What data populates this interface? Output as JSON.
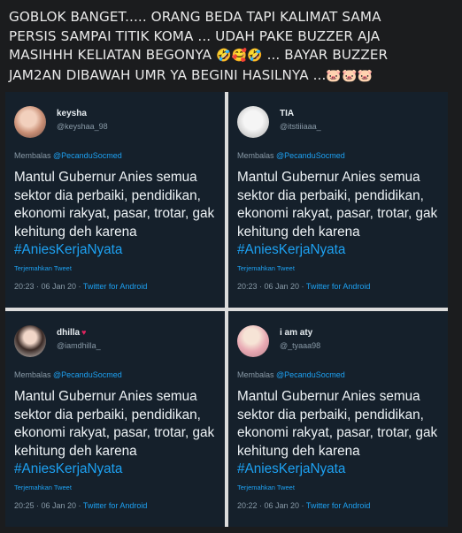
{
  "caption": {
    "line1": "GOBLOK BANGET..... ORANG BEDA TAPI KALIMAT SAMA",
    "line2": "PERSIS SAMPAI TITIK KOMA ... UDAH PAKE BUZZER AJA",
    "line3_text": "MASIHHH KELIATAN BEGONYA",
    "line3_emojis": "🤣🥰🤣",
    "line3_tail": "... BAYAR BUZZER",
    "line4_text": "JAM2AN DIBAWAH UMR YA BEGINI HASILNYA ...",
    "line4_emojis": "🐷🐷🐷"
  },
  "tweets": [
    {
      "name": "keysha",
      "handle": "@keyshaa_98",
      "reply_prefix": "Membalas",
      "mention": "@PecanduSocmed",
      "text": "Mantul Gubernur Anies semua sektor dia perbaiki, pendidikan, ekonomi rakyat, pasar, trotar, gak kehitung deh karena",
      "hashtag": "#AniesKerjaNyata",
      "translate": "Terjemahkan Tweet",
      "time": "20:23 · 06 Jan 20 ·",
      "via": "Twitter for Android"
    },
    {
      "name": "TIA",
      "handle": "@itstiiiaaa_",
      "reply_prefix": "Membalas",
      "mention": "@PecanduSocmed",
      "text": "Mantul Gubernur Anies semua sektor dia perbaiki, pendidikan, ekonomi rakyat, pasar, trotar, gak kehitung deh karena",
      "hashtag": "#AniesKerjaNyata",
      "translate": "Terjemahkan Tweet",
      "time": "20:23 · 06 Jan 20 ·",
      "via": "Twitter for Android"
    },
    {
      "name": "dhilla",
      "name_badge": "♥",
      "handle": "@iamdhilla_",
      "reply_prefix": "Membalas",
      "mention": "@PecanduSocmed",
      "text": "Mantul Gubernur Anies semua sektor dia perbaiki, pendidikan, ekonomi rakyat, pasar, trotar, gak kehitung deh karena",
      "hashtag": "#AniesKerjaNyata",
      "translate": "Terjemahkan Tweet",
      "time": "20:25 · 06 Jan 20 ·",
      "via": "Twitter for Android"
    },
    {
      "name": "i am aty",
      "handle": "@_tyaaa98",
      "reply_prefix": "Membalas",
      "mention": "@PecanduSocmed",
      "text": "Mantul Gubernur Anies semua sektor dia perbaiki, pendidikan, ekonomi rakyat, pasar, trotar, gak kehitung deh karena",
      "hashtag": "#AniesKerjaNyata",
      "translate": "Terjemahkan Tweet",
      "time": "20:22 · 06 Jan 20 ·",
      "via": "Twitter for Android"
    }
  ]
}
